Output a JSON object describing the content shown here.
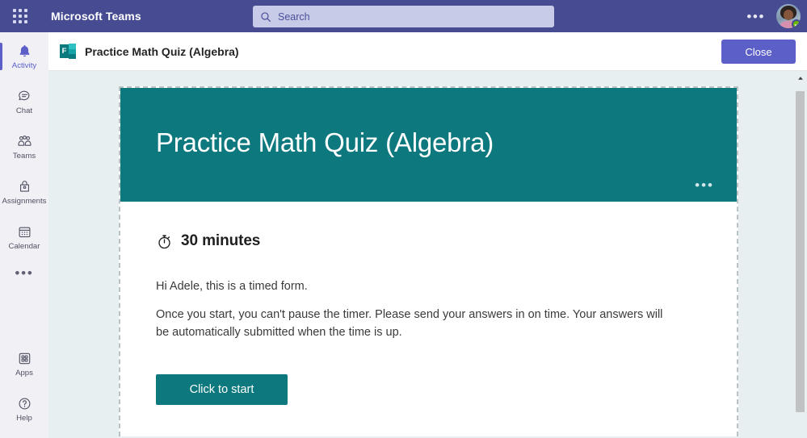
{
  "topbar": {
    "app_launcher_icon": "waffle-grid-icon",
    "brand": "Microsoft Teams",
    "search": {
      "placeholder": "Search",
      "value": "",
      "icon": "search-icon"
    },
    "overflow_icon": "•••",
    "avatar": {
      "alt": "User avatar",
      "presence": "Available",
      "presence_color": "#6bb700"
    },
    "bg_color": "#464b92"
  },
  "rail": {
    "items": [
      {
        "label": "Activity",
        "icon": "bell-icon",
        "active": true
      },
      {
        "label": "Chat",
        "icon": "chat-icon",
        "active": false
      },
      {
        "label": "Teams",
        "icon": "teams-icon",
        "active": false
      },
      {
        "label": "Assignments",
        "icon": "assignments-icon",
        "active": false
      },
      {
        "label": "Calendar",
        "icon": "calendar-icon",
        "active": false
      }
    ],
    "more_icon": "•••",
    "bottom": [
      {
        "label": "Apps",
        "icon": "apps-icon"
      },
      {
        "label": "Help",
        "icon": "help-icon"
      }
    ],
    "active_color": "#5b5fc7"
  },
  "app_header": {
    "icon": "microsoft-forms-icon",
    "icon_letter": "F",
    "title": "Practice Math Quiz (Algebra)",
    "close_label": "Close",
    "close_color": "#5b5fc7"
  },
  "form": {
    "banner_title": "Practice Math Quiz (Algebra)",
    "banner_color": "#0d787d",
    "banner_overflow_icon": "•••",
    "timer_icon": "stopwatch-icon",
    "timer_text": "30 minutes",
    "paragraph_1": "Hi Adele, this is a timed form.",
    "paragraph_2": "Once you start, you can't pause the timer. Please send your answers in on time. Your answers will be automatically submitted when the time is up.",
    "start_label": "Click to start",
    "start_color": "#0d787d"
  },
  "scrollbar": {
    "up_icon": "caret-up-icon"
  }
}
